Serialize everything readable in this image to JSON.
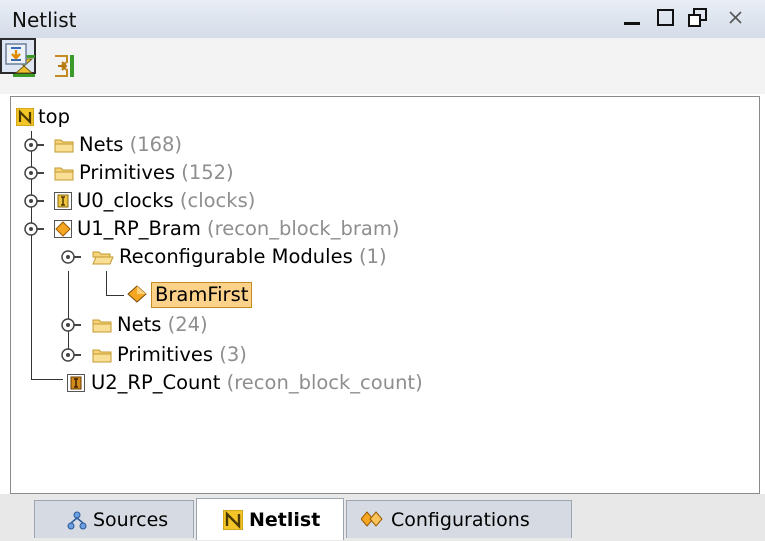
{
  "window": {
    "title": "Netlist"
  },
  "toolbar": {
    "collapse_all": "collapse-all-icon",
    "expand_all": "expand-all-icon",
    "auto_scroll": "auto-scroll-icon"
  },
  "tree": {
    "root": {
      "label": "top"
    },
    "nets": {
      "label": "Nets",
      "count": "(168)"
    },
    "primitives": {
      "label": "Primitives",
      "count": "(152)"
    },
    "u0": {
      "label": "U0_clocks",
      "count": "(clocks)"
    },
    "u1": {
      "label": "U1_RP_Bram",
      "count": "(recon_block_bram)"
    },
    "u1_reconfig": {
      "label": "Reconfigurable Modules",
      "count": "(1)"
    },
    "u1_bramfirst": {
      "label": "BramFirst"
    },
    "u1_nets": {
      "label": "Nets",
      "count": "(24)"
    },
    "u1_primitives": {
      "label": "Primitives",
      "count": "(3)"
    },
    "u2": {
      "label": "U2_RP_Count",
      "count": "(recon_block_count)"
    }
  },
  "tabs": [
    {
      "label": "Sources"
    },
    {
      "label": "Netlist"
    },
    {
      "label": "Configurations"
    }
  ],
  "colors": {
    "selection": "#fcd28a",
    "folder": "#f1c04a",
    "count_text": "#8e8e8e"
  }
}
